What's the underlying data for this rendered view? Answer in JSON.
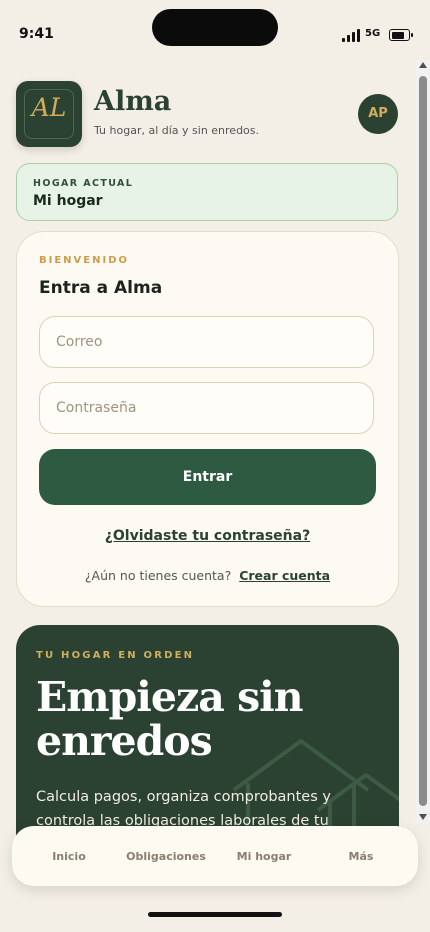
{
  "status": {
    "time": "9:41",
    "network": "5G"
  },
  "header": {
    "logo_text": "AL",
    "title": "Alma",
    "tagline": "Tu hogar, al día y sin enredos.",
    "avatar_initials": "AP"
  },
  "household": {
    "label": "HOGAR ACTUAL",
    "value": "Mi hogar"
  },
  "login": {
    "eyebrow": "BIENVENIDO",
    "title": "Entra a Alma",
    "email_placeholder": "Correo",
    "password_placeholder": "Contraseña",
    "submit_label": "Entrar",
    "forgot_label": "¿Olvidaste tu contraseña?",
    "no_account_text": "¿Aún no tienes cuenta?",
    "signup_label": "Crear cuenta"
  },
  "hero": {
    "eyebrow": "TU HOGAR EN ORDEN",
    "title": "Empieza sin enredos",
    "description": "Calcula pagos, organiza comprobantes y controla las obligaciones laborales de tu hogar."
  },
  "nav": {
    "items": [
      {
        "label": "Inicio"
      },
      {
        "label": "Obligaciones"
      },
      {
        "label": "Mi hogar"
      },
      {
        "label": "Más"
      }
    ]
  },
  "colors": {
    "brand": "#2b4233",
    "accent": "#d1ae5c",
    "button": "#2f5a42",
    "background": "#f3eee6",
    "household_bg": "#e7f3e6"
  }
}
